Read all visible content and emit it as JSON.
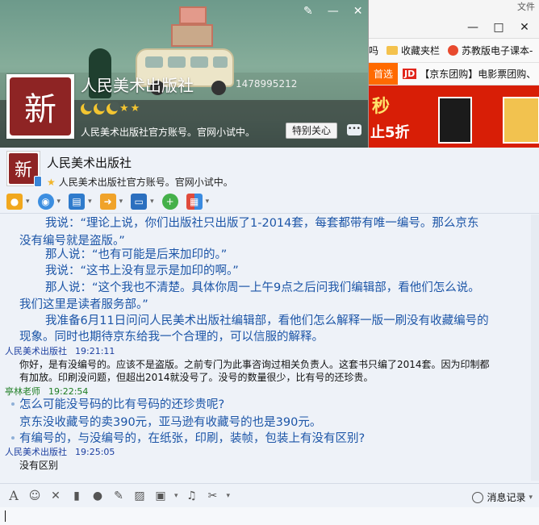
{
  "browser": {
    "corner_text": "文件",
    "controls": [
      "—",
      "□",
      "✕"
    ],
    "bookmarks": [
      {
        "label": "吗",
        "icon": "none"
      },
      {
        "label": "收藏夹栏",
        "icon": "folder-icon"
      },
      {
        "label": "苏教版电子课本-",
        "icon": "flower-icon"
      }
    ],
    "tab_first": "首选",
    "tab_jd_logo": "JD",
    "tab_jd_text": "【京东团购】电影票团购、",
    "ad_line1": "秒",
    "ad_line2": "止5折",
    "ad_color": "#d81e06"
  },
  "card": {
    "name": "人民美术出版社",
    "id": "1478995212",
    "signature": "人民美术出版社官方账号。官网小试中。",
    "follow_button": "特别关心",
    "seal_char": "新",
    "controls": {
      "skin": "✎",
      "minimize": "—",
      "close": "✕"
    }
  },
  "chat": {
    "title": "人民美术出版社",
    "signature": "人民美术出版社官方账号。官网小试中。",
    "toolbar_icons": [
      "voice-icon",
      "video-icon",
      "screen-share-icon",
      "file-transfer-icon",
      "remote-assist-icon",
      "add-group-icon",
      "apps-icon"
    ],
    "history_label": "消息记录",
    "dropdown": "▾"
  },
  "messages": {
    "l1": "我说：“理论上说，你们出版社只出版了1-2014套，每套都带有唯一编号。那么京东",
    "l2": "没有编号就是盗版。”",
    "l3": "那人说：“也有可能是后来加印的。”",
    "l4": "我说：“这书上没有显示是加印的啊。”",
    "l5": "那人说：“这个我也不清楚。具体你周一上午9点之后问我们编辑部，看他们怎么说。",
    "l6": "我们这里是读者服务部。”",
    "l7": "我准备6月11日问问人民美术出版社编辑部，看他们怎么解释一版一刷没有收藏编号的",
    "l8": "现象。同时也期待京东给我一个合理的，可以信服的解释。",
    "s1_name": "人民美术出版社",
    "s1_time": "19:21:11",
    "r1a": "你好，是有没编号的。应该不是盗版。之前专门为此事咨询过相关负责人。这套书只编了2014套。因为印制都",
    "r1b": "有加放。印刷没问题，但超出2014就没号了。没号的数量很少，比有号的还珍贵。",
    "s2_name": "亭林老师",
    "s2_time": "19:22:54",
    "q1": "怎么可能没号码的比有号码的还珍贵呢?",
    "q2": "京东没收藏号的卖390元，亚马逊有收藏号的也是390元。",
    "q3": "有编号的，与没编号的，在纸张，印刷，装帧，包装上有没有区别?",
    "s3_name": "人民美术出版社",
    "s3_time": "19:25:05",
    "r2": "没有区别"
  }
}
